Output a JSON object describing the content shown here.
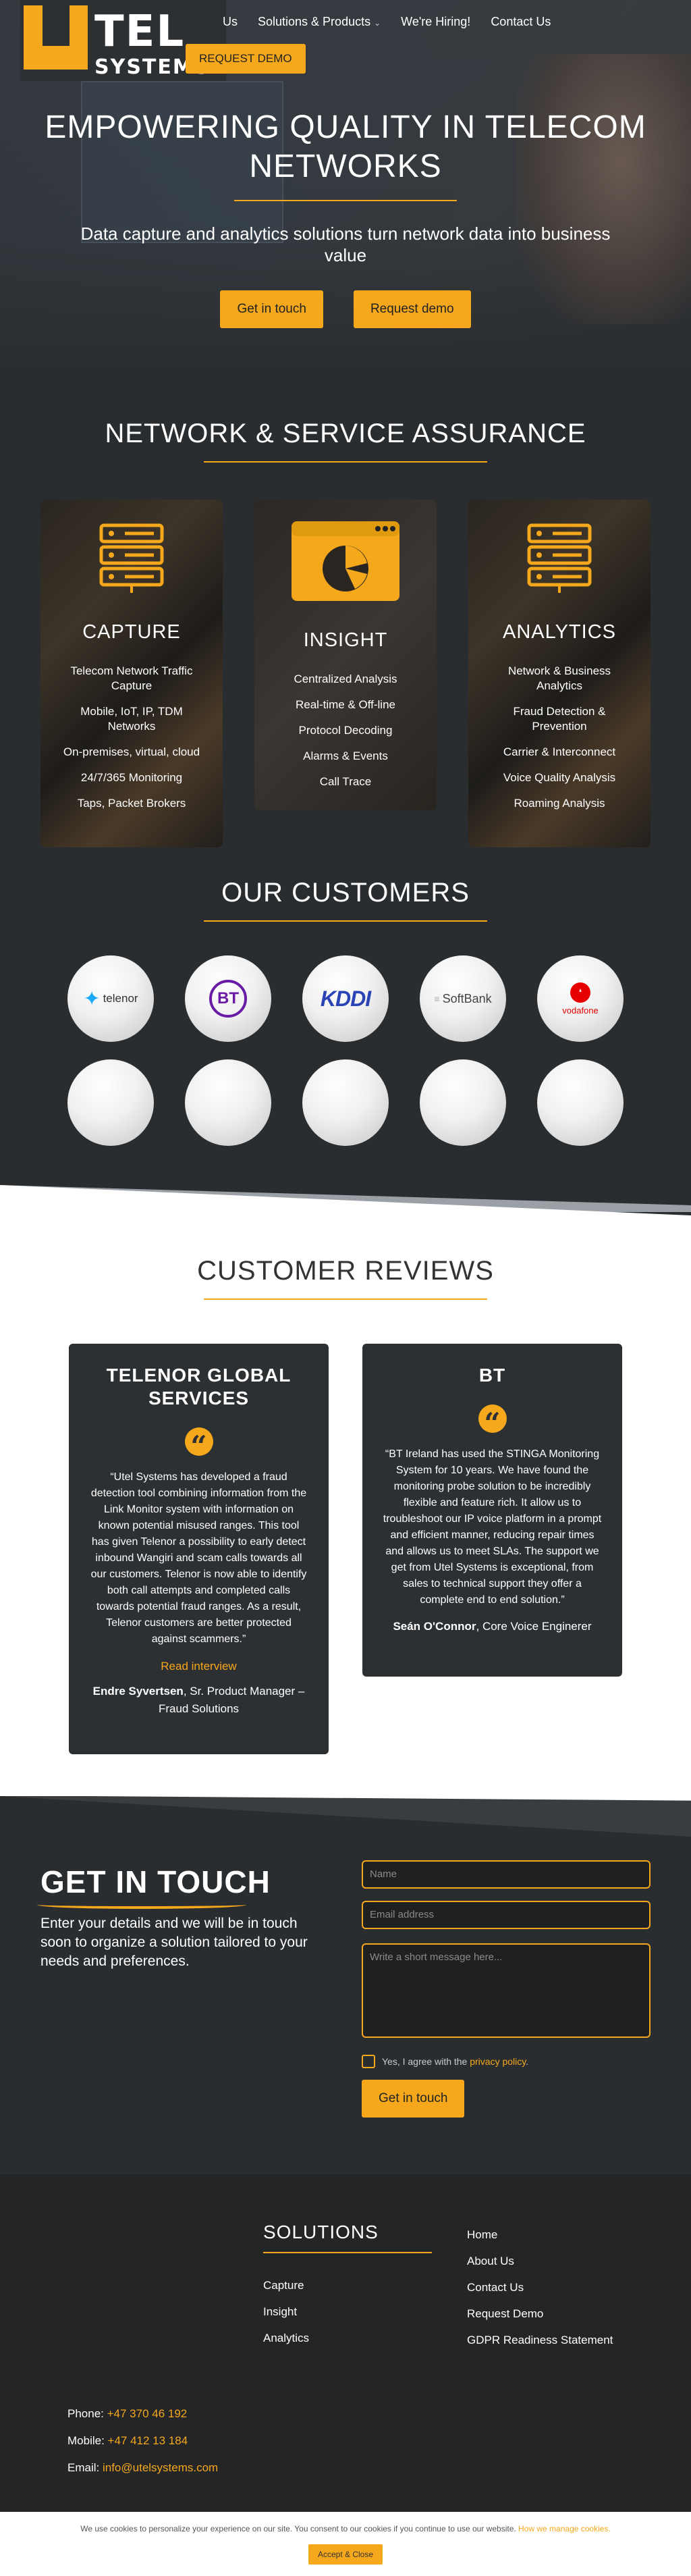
{
  "logo": {
    "line1": "TEL",
    "line2": "SYSTEMS"
  },
  "nav": {
    "items": [
      "Us",
      "Solutions & Products",
      "We're Hiring!",
      "Contact Us"
    ],
    "chevron": "⌄",
    "request_demo": "REQUEST DEMO"
  },
  "hero": {
    "title": "EMPOWERING QUALITY IN TELECOM NETWORKS",
    "subtitle": "Data capture and analytics solutions turn network data into business value",
    "btn_primary": "Get in touch",
    "btn_secondary": "Request demo"
  },
  "services": {
    "title": "NETWORK & SERVICE ASSURANCE",
    "cards": [
      {
        "title": "CAPTURE",
        "icon": "server-icon",
        "items": [
          "Telecom Network Traffic Capture",
          "Mobile, IoT, IP, TDM Networks",
          "On-premises, virtual, cloud",
          "24/7/365 Monitoring",
          "Taps, Packet Brokers"
        ]
      },
      {
        "title": "INSIGHT",
        "icon": "dashboard-icon",
        "items": [
          "Centralized Analysis",
          "Real-time & Off-line",
          "Protocol Decoding",
          "Alarms & Events",
          "Call Trace"
        ]
      },
      {
        "title": "ANALYTICS",
        "icon": "server-icon",
        "items": [
          "Network & Business Analytics",
          "Fraud Detection & Prevention",
          "Carrier & Interconnect",
          "Voice Quality Analysis",
          "Roaming Analysis"
        ]
      }
    ]
  },
  "customers": {
    "title": "OUR CUSTOMERS",
    "logos": [
      "telenor",
      "BT",
      "KDDI",
      "SoftBank",
      "vodafone"
    ]
  },
  "reviews": {
    "title": "CUSTOMER REVIEWS",
    "items": [
      {
        "company": "TELENOR GLOBAL SERVICES",
        "quote": "“Utel Systems has developed a fraud detection tool combining information from the Link Monitor system with information on known potential misused ranges. This tool has given Telenor a possibility to early detect inbound Wangiri and scam calls towards all our customers. Telenor is now able to identify both call attempts and completed calls towards potential fraud ranges. As a result, Telenor customers are better protected against scammers.”",
        "link": "Read interview",
        "author": "Endre Syvertsen",
        "role": ", Sr. Product Manager – Fraud Solutions"
      },
      {
        "company": "BT",
        "quote": "“BT Ireland has used the STINGA Monitoring System for 10 years. We have found the monitoring probe solution to be incredibly flexible and feature rich. It allow us to troubleshoot our IP voice platform in a prompt and efficient manner, reducing repair times and allows us to meet SLAs. The support we get from Utel Systems is exceptional, from sales to technical support they offer a complete end to end solution.”",
        "author": "Seán O'Connor",
        "role": ", Core Voice Enginerer"
      }
    ]
  },
  "contact": {
    "title": "GET IN TOUCH",
    "text": "Enter your details and we will be in touch soon to organize a solution tailored to your needs and preferences.",
    "name_placeholder": "Name",
    "email_placeholder": "Email address",
    "message_placeholder": "Write a short message here...",
    "agree_prefix": "Yes, I agree with the ",
    "agree_link": "privacy policy",
    "agree_suffix": ".",
    "submit": "Get in touch"
  },
  "footer": {
    "solutions_title": "SOLUTIONS",
    "solutions": [
      "Capture",
      "Insight",
      "Analytics"
    ],
    "links": [
      "Home",
      "About Us",
      "Contact Us",
      "Request Demo",
      "GDPR Readiness Statement"
    ],
    "phone_label": "Phone: ",
    "phone": "+47 370 46 192",
    "mobile_label": "Mobile: ",
    "mobile": "+47 412 13 184",
    "email_label": "Email: ",
    "email": "info@utelsystems.com"
  },
  "cookie": {
    "text": "We use cookies to personalize your experience on our site. You consent to our cookies if you continue to use our website. ",
    "link": "How we manage cookies.",
    "accept": "Accept & Close"
  },
  "colors": {
    "accent": "#f5a81c",
    "dark": "#2a2d30"
  }
}
